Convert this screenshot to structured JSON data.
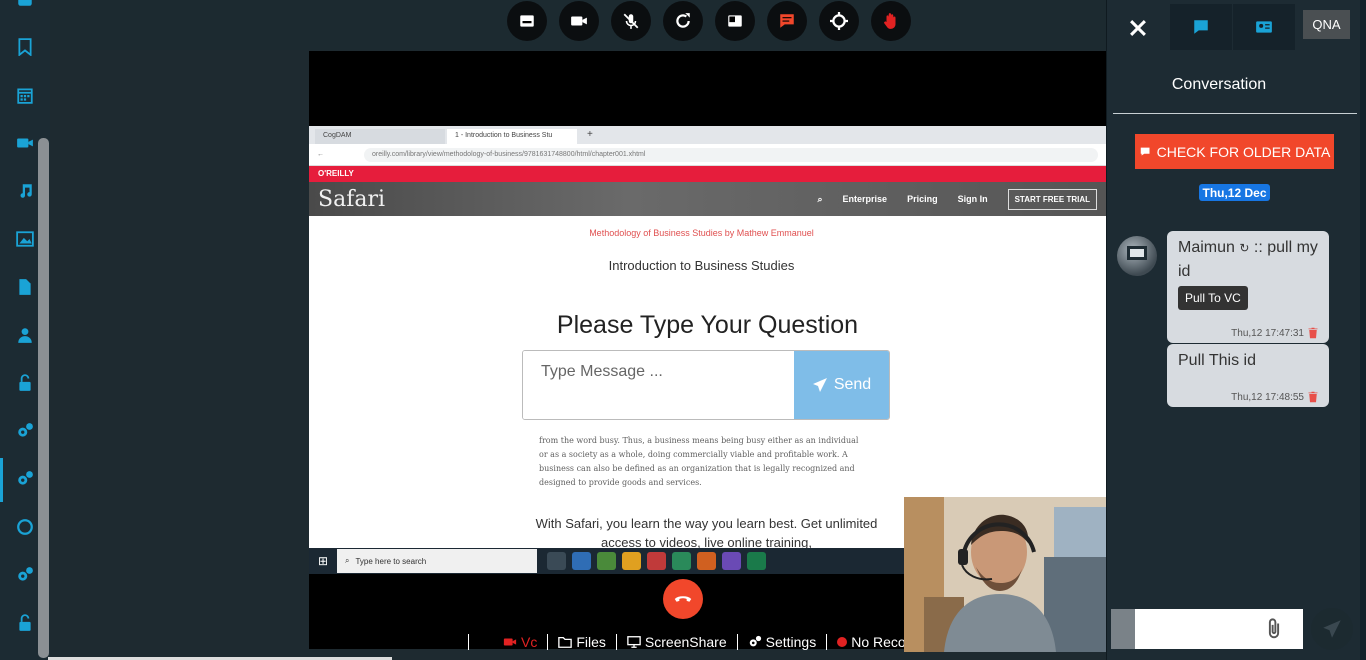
{
  "toolbar": {
    "buttons": [
      "caption-icon",
      "video-camera-icon",
      "mic-muted-icon",
      "refresh-icon",
      "layout-icon",
      "chat-icon",
      "target-icon",
      "raise-hand-icon"
    ],
    "chat_color": "#f1472b",
    "hand_color": "#e12222"
  },
  "sidebar": {
    "items": [
      "bookmark-icon",
      "calendar-icon",
      "video-icon",
      "music-icon",
      "image-icon",
      "file-icon",
      "user-icon",
      "unlock-icon",
      "gears-icon",
      "gears-icon-active",
      "circle-icon",
      "gears-icon",
      "unlock-icon"
    ]
  },
  "shared_screen": {
    "tabs": [
      {
        "label": "CogDAM"
      },
      {
        "label": "1 - Introduction to Business Stu"
      }
    ],
    "address": "oreilly.com/library/view/methodology-of-business/9781631748800/html/chapter001.xhtml",
    "oreilly_strip": "O'REILLY",
    "brand": "Safari",
    "nav": [
      "Enterprise",
      "Pricing",
      "Sign In"
    ],
    "trial_button": "START FREE TRIAL",
    "book_title": "Methodology of Business Studies by Mathew Emmanuel",
    "section_title": "Introduction to Business Studies",
    "paragraph": "from the word busy. Thus, a business means being busy either as an individual or as a society as a whole, doing commercially viable and profitable work. A business can also be defined as an organization that is legally recognized and designed to provide goods and services.",
    "promo": "With Safari, you learn the way you learn best. Get unlimited access to videos, live online training,",
    "taskbar_search": "Type here to search"
  },
  "question_form": {
    "heading": "Please Type Your Question",
    "placeholder": "Type Message ...",
    "send_label": "Send"
  },
  "bottom_controls": {
    "vc": "Vc",
    "files": "Files",
    "screenshare": "ScreenShare",
    "settings": "Settings",
    "recording": "No Reco"
  },
  "panel": {
    "qna_tab": "QNA",
    "title": "Conversation",
    "older_button": "CHECK FOR OLDER DATA",
    "date_badge": "Thu,12 Dec",
    "messages": [
      {
        "sender": "Maimun",
        "text": ":: pull my id",
        "action": "Pull To VC",
        "time": "Thu,12 17:47:31"
      },
      {
        "text": "Pull This id",
        "time": "Thu,12 17:48:55"
      }
    ]
  }
}
